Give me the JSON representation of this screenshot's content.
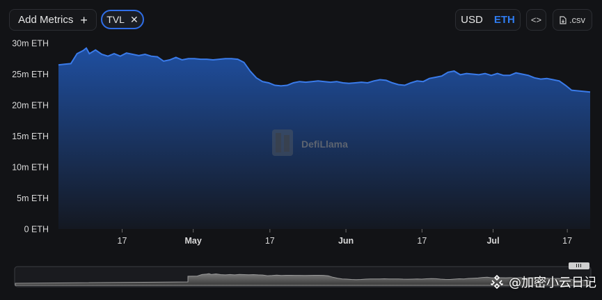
{
  "toolbar": {
    "add_metrics_label": "Add Metrics",
    "add_icon": "plus-icon",
    "metric_chip_label": "TVL",
    "chip_close_icon": "close-icon",
    "denominations": [
      "USD",
      "ETH"
    ],
    "active_denomination": "ETH",
    "embed_label": "<>",
    "csv_label": ".csv",
    "csv_icon": "file-download-icon"
  },
  "watermark": "DefiLlama",
  "brand_tag": "@加密小云日记",
  "colors": {
    "line": "#3a7bea",
    "area_top": "#1f4fa0",
    "area_bottom": "#141821",
    "accent": "#2f7cf0"
  },
  "chart_data": {
    "type": "area",
    "unit": "ETH",
    "y_ticks": [
      "0 ETH",
      "5m ETH",
      "10m ETH",
      "15m ETH",
      "20m ETH",
      "25m ETH",
      "30m ETH"
    ],
    "ylim": [
      0,
      30
    ],
    "x_ticks": [
      "17",
      "May",
      "17",
      "Jun",
      "17",
      "Jul",
      "17"
    ],
    "grid": false,
    "series": [
      {
        "points": [
          [
            0,
            26.5
          ],
          [
            1,
            26.6
          ],
          [
            2,
            26.7
          ],
          [
            3,
            28.3
          ],
          [
            4,
            28.8
          ],
          [
            4.5,
            29.2
          ],
          [
            5,
            28.3
          ],
          [
            6,
            28.9
          ],
          [
            7,
            28.2
          ],
          [
            8,
            27.9
          ],
          [
            9,
            28.3
          ],
          [
            10,
            27.9
          ],
          [
            11,
            28.4
          ],
          [
            12,
            28.2
          ],
          [
            13,
            28.0
          ],
          [
            14,
            28.2
          ],
          [
            15,
            27.9
          ],
          [
            16,
            27.8
          ],
          [
            17,
            27.1
          ],
          [
            18,
            27.3
          ],
          [
            19,
            27.7
          ],
          [
            20,
            27.3
          ],
          [
            21,
            27.5
          ],
          [
            22,
            27.5
          ],
          [
            23,
            27.4
          ],
          [
            24,
            27.4
          ],
          [
            25,
            27.3
          ],
          [
            26,
            27.4
          ],
          [
            27,
            27.5
          ],
          [
            28,
            27.5
          ],
          [
            29,
            27.4
          ],
          [
            30,
            26.9
          ],
          [
            31,
            25.5
          ],
          [
            32,
            24.4
          ],
          [
            33,
            23.8
          ],
          [
            34,
            23.6
          ],
          [
            35,
            23.2
          ],
          [
            36,
            23.1
          ],
          [
            37,
            23.2
          ],
          [
            38,
            23.6
          ],
          [
            39,
            23.8
          ],
          [
            40,
            23.7
          ],
          [
            41,
            23.8
          ],
          [
            42,
            23.9
          ],
          [
            43,
            23.8
          ],
          [
            44,
            23.7
          ],
          [
            45,
            23.8
          ],
          [
            46,
            23.6
          ],
          [
            47,
            23.5
          ],
          [
            48,
            23.6
          ],
          [
            49,
            23.7
          ],
          [
            50,
            23.6
          ],
          [
            51,
            23.9
          ],
          [
            52,
            24.1
          ],
          [
            53,
            24.0
          ],
          [
            54,
            23.6
          ],
          [
            55,
            23.3
          ],
          [
            56,
            23.2
          ],
          [
            57,
            23.6
          ],
          [
            58,
            23.9
          ],
          [
            59,
            23.8
          ],
          [
            60,
            24.3
          ],
          [
            61,
            24.5
          ],
          [
            62,
            24.7
          ],
          [
            63,
            25.3
          ],
          [
            64,
            25.5
          ],
          [
            65,
            24.9
          ],
          [
            66,
            25.1
          ],
          [
            67,
            25.0
          ],
          [
            68,
            24.9
          ],
          [
            69,
            25.1
          ],
          [
            70,
            24.8
          ],
          [
            71,
            25.1
          ],
          [
            72,
            24.8
          ],
          [
            73,
            24.8
          ],
          [
            74,
            25.2
          ],
          [
            75,
            25.0
          ],
          [
            76,
            24.8
          ],
          [
            77,
            24.4
          ],
          [
            78,
            24.2
          ],
          [
            79,
            24.3
          ],
          [
            80,
            24.1
          ],
          [
            81,
            23.9
          ],
          [
            82,
            23.2
          ],
          [
            83,
            22.4
          ],
          [
            84,
            22.3
          ],
          [
            85,
            22.2
          ],
          [
            86,
            22.1
          ]
        ]
      }
    ],
    "x_tick_positions": [
      10.3,
      21.8,
      34.2,
      46.5,
      58.8,
      70.3,
      82.3
    ],
    "xlim": [
      0,
      86
    ]
  }
}
